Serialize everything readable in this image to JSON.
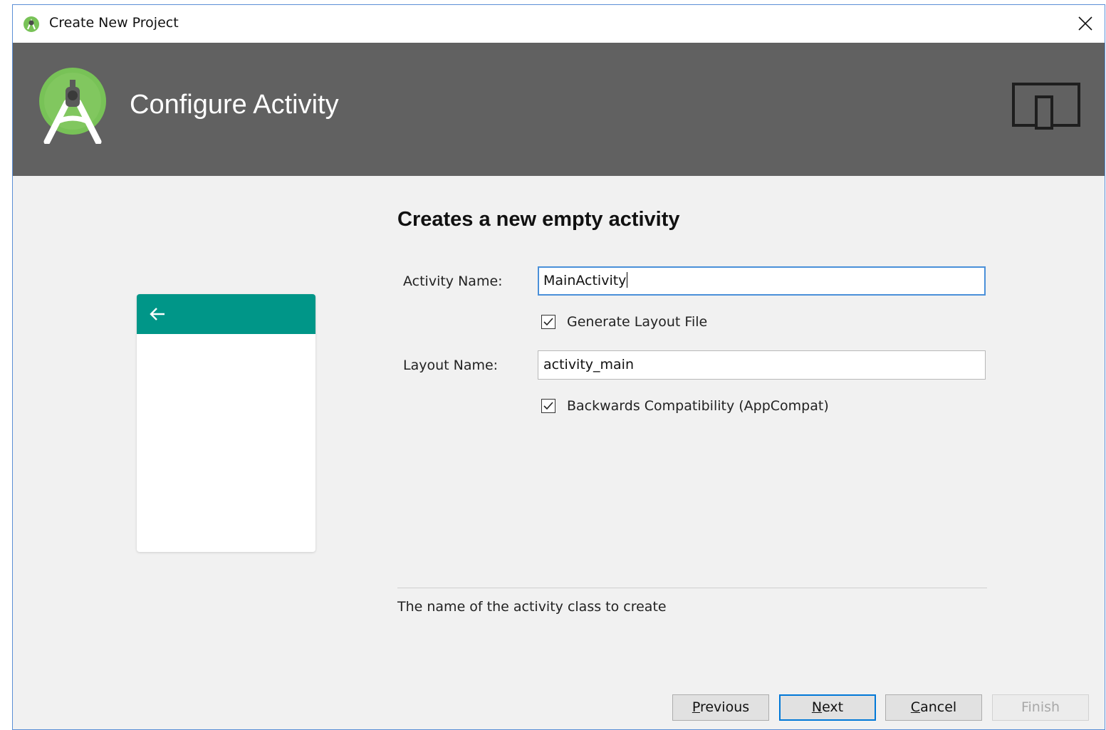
{
  "window": {
    "title": "Create New Project",
    "app_icon": "android-studio-icon",
    "close_icon": "close-icon"
  },
  "header": {
    "title": "Configure Activity",
    "logo_icon": "android-studio-logo",
    "device_icon": "tablet-phone-device-icon",
    "background": "#616161"
  },
  "preview": {
    "appbar_color": "#009688",
    "back_icon": "arrow-left-icon"
  },
  "form": {
    "heading": "Creates a new empty activity",
    "activity_name_label": "Activity Name:",
    "activity_name_value": "MainActivity",
    "generate_layout_label": "Generate Layout File",
    "generate_layout_checked": true,
    "layout_name_label": "Layout Name:",
    "layout_name_value": "activity_main",
    "backwards_compat_label": "Backwards Compatibility (AppCompat)",
    "backwards_compat_checked": true,
    "help_text": "The name of the activity class to create"
  },
  "buttons": {
    "previous": {
      "mnemonic": "P",
      "rest": "revious"
    },
    "next": {
      "mnemonic": "N",
      "rest": "ext"
    },
    "cancel": {
      "mnemonic": "C",
      "rest": "ancel"
    },
    "finish": "Finish"
  },
  "colors": {
    "accent_focus": "#4a90d9",
    "default_button_border": "#0078d7",
    "logo_green": "#78c257"
  }
}
